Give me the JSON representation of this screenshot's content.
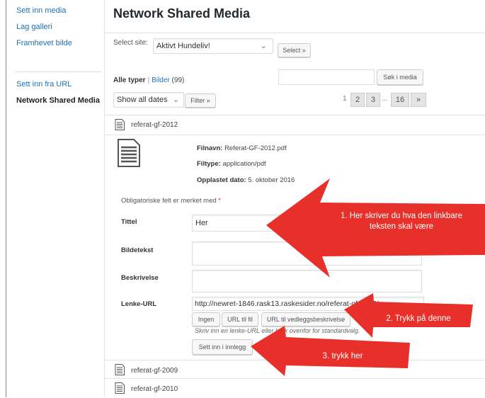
{
  "sidebar": {
    "items": [
      {
        "label": "Sett inn media"
      },
      {
        "label": "Lag galleri"
      },
      {
        "label": "Framhevet bilde"
      },
      {
        "label": "Sett inn fra URL"
      },
      {
        "label": "Network Shared Media"
      }
    ]
  },
  "header": {
    "title": "Network Shared Media"
  },
  "site_select": {
    "label": "Select site:",
    "value": "Aktivt Hundeliv!",
    "button": "Select »"
  },
  "filters": {
    "all_types": "Alle typer",
    "images_link": "Bilder",
    "images_count": "(99)",
    "dates_value": "Show all dates",
    "filter_button": "Filter »",
    "search_button": "Søk i media"
  },
  "pagination": {
    "current": "1",
    "pages": [
      "2",
      "3"
    ],
    "ellipsis": "...",
    "last": "16",
    "next": "»"
  },
  "attachments": [
    {
      "name": "referat-gf-2012"
    },
    {
      "name": "referat-gf-2009"
    },
    {
      "name": "referat-gf-2010"
    }
  ],
  "details": {
    "filename_label": "Filnavn:",
    "filename": "Referat-GF-2012.pdf",
    "filetype_label": "Filtype:",
    "filetype": "application/pdf",
    "uploaded_label": "Opplastet dato:",
    "uploaded": "5. oktober 2016",
    "required_note": "Obligatoriske felt er merket med",
    "required_star": "*",
    "title_label": "Tittel",
    "title_value": "Her",
    "caption_label": "Bildetekst",
    "description_label": "Beskrivelse",
    "link_label": "Lenke-URL",
    "link_value": "http://newret-1846.rask13.raskesider.no/referat-gf-2012/",
    "btn_none": "Ingen",
    "btn_file_url": "URL til fil",
    "btn_attachment_url": "URL til vedleggsbeskrivelse",
    "help_text": "Skriv inn en lenke-URL eller klikk ovenfor for standardvalg.",
    "insert_button": "Sett inn i innlegg"
  },
  "annotations": {
    "arrow1": "1. Her skriver du hva den linkbare teksten skal være",
    "arrow2": "2. Trykk på denne",
    "arrow3": "3. trykk her",
    "arrow_color": "#e8302a"
  }
}
